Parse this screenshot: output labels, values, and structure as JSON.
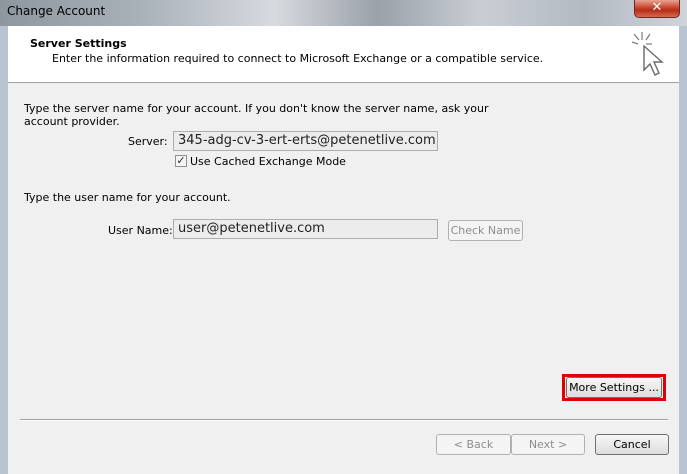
{
  "window": {
    "title": "Change Account",
    "close_glyph": "✕"
  },
  "header": {
    "title": "Server Settings",
    "description": "Enter the information required to connect to Microsoft Exchange or a compatible service.",
    "icon": "cursor-sparkle-icon"
  },
  "server_section": {
    "instruction_line1": "Type the server name for your account. If you don't know the server name, ask your",
    "instruction_line2": "account provider.",
    "server_label": "Server:",
    "server_value": "345-adg-cv-3-ert-erts@petenetlive.com",
    "cached_mode_label": "Use Cached Exchange Mode",
    "cached_mode_checked": true,
    "check_glyph": "✓"
  },
  "user_section": {
    "instruction": "Type the user name for your account.",
    "user_label": "User Name:",
    "user_value": "user@petenetlive.com",
    "check_name_label": "Check Name"
  },
  "buttons": {
    "more_settings": "More Settings ...",
    "back": "< Back",
    "next": "Next >",
    "cancel": "Cancel"
  },
  "colors": {
    "highlight": "#e00000",
    "close_button": "#c8452f"
  }
}
